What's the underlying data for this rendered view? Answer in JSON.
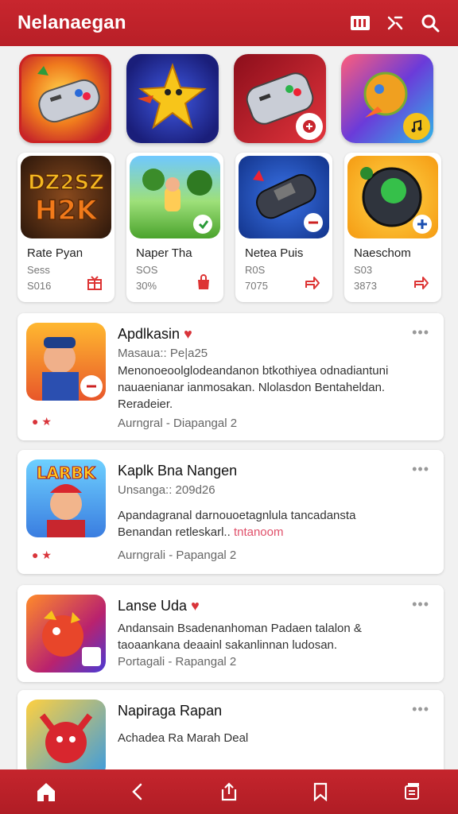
{
  "header": {
    "title": "Nelanaegan"
  },
  "cards": [
    {
      "name": "Rate Pyan",
      "sub": "Sess",
      "rating": "S016"
    },
    {
      "name": "Naper Tha",
      "sub": "SOS",
      "rating": "30%"
    },
    {
      "name": "Netea Puis",
      "sub": "R0S",
      "rating": "7075"
    },
    {
      "name": "Naeschom",
      "sub": "S03",
      "rating": "3873"
    }
  ],
  "icon2_text": "DZ2SZ H2K",
  "icon3_text": "LARBK",
  "list": [
    {
      "title": "Apdlkasin",
      "meta": "Masaua:: Pe|a25",
      "desc": "Menonoeoolglodeandanon btkothiyea odnadiantuni nauaenianar ianmosakan. Nlolasdon Bentaheldan. Reradeier.",
      "foot": "Aurngral - Diapangal 2"
    },
    {
      "title": "Kaplk Bna Nangen",
      "meta": "Unsanga:: 209d26",
      "desc": "Apandagranal darnouoetagnlula tancadansta Benandan retleskarl..",
      "desc_pink": "tntanoom",
      "foot": "Aurngrali - Papangal 2"
    },
    {
      "title": "Lanse Uda",
      "meta": "",
      "desc": "Andansain Bsadenanhoman Padaen talalon & taoaankana deaainl sakanlinnan ludosan.",
      "foot": "Portagali - Rapangal 2"
    },
    {
      "title": "Napiraga Rapan",
      "meta": "",
      "desc": "Achadea Ra Marah Deal",
      "foot": ""
    }
  ]
}
